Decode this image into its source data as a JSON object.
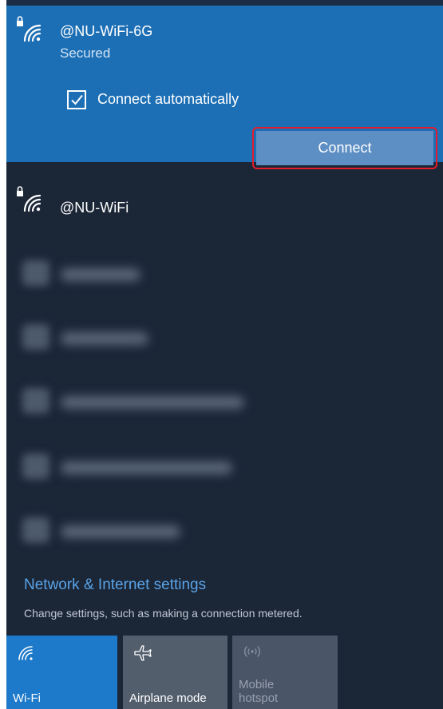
{
  "networks": {
    "selected": {
      "name": "@NU-WiFi-6G",
      "status": "Secured",
      "auto_connect_label": "Connect automatically",
      "auto_connect_checked": true,
      "connect_label": "Connect",
      "icon": "wifi-secured-icon"
    },
    "second": {
      "name": "@NU-WiFi",
      "icon": "wifi-secured-icon"
    },
    "blurred_count": 5
  },
  "settings": {
    "title": "Network & Internet settings",
    "subtitle": "Change settings, such as making a connection metered."
  },
  "quick_actions": [
    {
      "label": "Wi-Fi",
      "icon": "wifi-icon",
      "active": true
    },
    {
      "label": "Airplane mode",
      "icon": "airplane-icon",
      "active": false
    },
    {
      "label_line1": "Mobile",
      "label_line2": "hotspot",
      "icon": "mobile-hotspot-icon",
      "active": false,
      "disabled": true
    }
  ],
  "colors": {
    "panel_bg": "#1b2637",
    "accent": "#1d6fb5",
    "connect_button": "#5d8fc4",
    "highlight_outline": "#e21c2a",
    "link": "#5aa3e6"
  }
}
